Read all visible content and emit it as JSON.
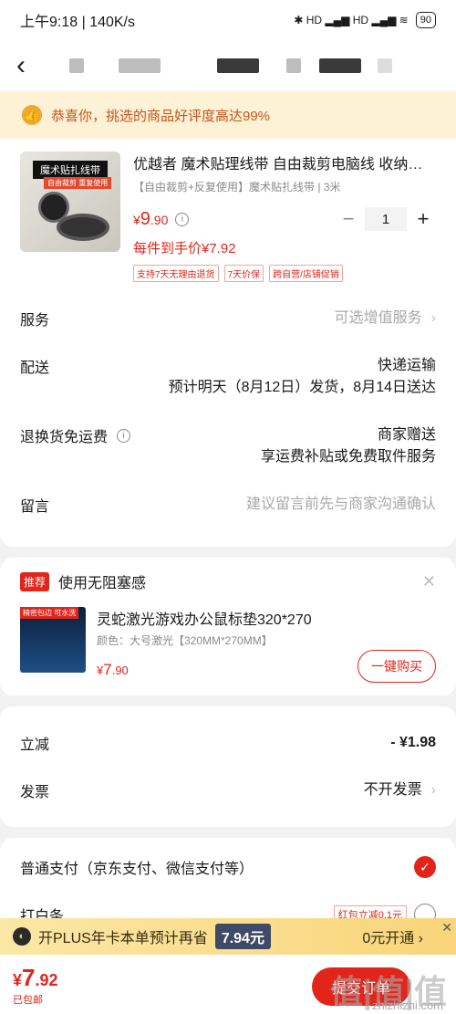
{
  "status_bar": {
    "time": "上午9:18 | 140K/s",
    "network": "✱ HD ▂▄▆ HD ▂▄▆ ≋",
    "battery": "90"
  },
  "banner": {
    "text": "恭喜你，挑选的商品好评度高达99%"
  },
  "product": {
    "image_tag": "魔术贴扎线带",
    "image_sub": "自由裁剪 重复使用",
    "title": "优越者 魔术贴理线带 自由裁剪电脑线 收纳…",
    "spec": "【自由裁剪+反复使用】魔术贴扎线带 | 3米",
    "price_symbol": "¥",
    "price_int": "9",
    "price_dec": ".90",
    "quantity": "1",
    "unit_price": "每件到手价¥7.92",
    "badges": [
      "支持7天无理由退货",
      "7天价保",
      "跨自营/店铺促销"
    ]
  },
  "rows": {
    "service": {
      "label": "服务",
      "value": "可选增值服务"
    },
    "delivery": {
      "label": "配送",
      "value1": "快递运输",
      "value2": "预计明天（8月12日）发货，8月14日送达"
    },
    "return": {
      "label": "退换货免运费",
      "value1": "商家赠送",
      "value2": "享运费补贴或免费取件服务"
    },
    "note": {
      "label": "留言",
      "placeholder": "建议留言前先与商家沟通确认"
    }
  },
  "recommend": {
    "tag": "推荐",
    "title": "使用无阻塞感",
    "image_tag": "精密包边 可水洗",
    "item_title": "灵蛇激光游戏办公鼠标垫320*270",
    "item_spec": "颜色：大号激光【320MM*270MM】",
    "price_symbol": "¥",
    "price_int": "7",
    "price_dec": ".90",
    "buy_label": "一键购买"
  },
  "discount": {
    "label": "立减",
    "value": "- ¥1.98",
    "invoice_label": "发票",
    "invoice_value": "不开发票"
  },
  "payment": {
    "normal_label": "普通支付（京东支付、微信支付等）",
    "baitiao_label": "打白条",
    "baitiao_badge": "红包立减0.1元"
  },
  "plus_bar": {
    "icon": "◐",
    "text": "开PLUS年卡本单预计再省",
    "amount": "7.94元",
    "action": "0元开通 ›",
    "close": "✕"
  },
  "bottom": {
    "total_symbol": "¥",
    "total_int": "7",
    "total_dec": ".92",
    "shipping": "已包邮",
    "submit_label": "提交订单",
    "watermark": "值|值|值",
    "watermark_sub": "zhizhizhi.com"
  }
}
